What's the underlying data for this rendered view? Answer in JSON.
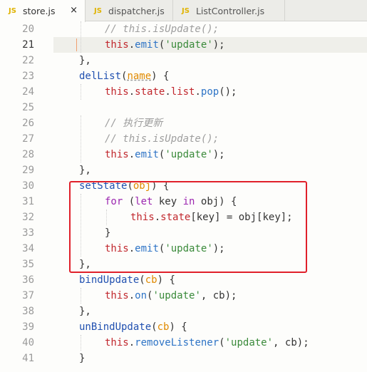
{
  "tabs": [
    {
      "icon": "JS",
      "label": "store.js",
      "close": "×",
      "active": true
    },
    {
      "icon": "JS",
      "label": "dispatcher.js",
      "active": false
    },
    {
      "icon": "JS",
      "label": "ListController.js",
      "active": false
    }
  ],
  "gutter": {
    "line_numbers": [
      "20",
      "21",
      "22",
      "23",
      "24",
      "25",
      "26",
      "27",
      "28",
      "29",
      "30",
      "31",
      "32",
      "33",
      "34",
      "35",
      "36",
      "37",
      "38",
      "39",
      "40",
      "41"
    ],
    "current_line": "21"
  },
  "code": {
    "l20": {
      "comment": "// this.isUpdate();"
    },
    "l21": {
      "this": "this",
      "dot": ".",
      "method": "emit",
      "open": "(",
      "str": "'update'",
      "close": ");"
    },
    "l22": {
      "text": "},"
    },
    "l23": {
      "name": "delList",
      "open": "(",
      "param": "name",
      "close": ") {"
    },
    "l24": {
      "this": "this",
      "dot1": ".",
      "state": "state",
      "dot2": ".",
      "list": "list",
      "dot3": ".",
      "method": "pop",
      "tail": "();"
    },
    "l26": {
      "comment": "// 执行更新"
    },
    "l27": {
      "comment": "// this.isUpdate();"
    },
    "l28": {
      "this": "this",
      "dot": ".",
      "method": "emit",
      "open": "(",
      "str": "'update'",
      "close": ");"
    },
    "l29": {
      "text": "},"
    },
    "l30": {
      "name": "setState",
      "open": "(",
      "param": "obj",
      "close": ") {"
    },
    "l31": {
      "kw_for": "for",
      "open": " (",
      "kw_let": "let",
      "mid": " key ",
      "kw_in": "in",
      "tail": " obj) {"
    },
    "l32": {
      "this": "this",
      "dot": ".",
      "state": "state",
      "tail": "[key] = obj[key];"
    },
    "l33": {
      "text": "}"
    },
    "l34": {
      "this": "this",
      "dot": ".",
      "method": "emit",
      "open": "(",
      "str": "'update'",
      "close": ");"
    },
    "l35": {
      "text": "},"
    },
    "l36": {
      "name": "bindUpdate",
      "open": "(",
      "param": "cb",
      "close": ") {"
    },
    "l37": {
      "this": "this",
      "dot": ".",
      "method": "on",
      "open": "(",
      "str": "'update'",
      "close": ", cb);"
    },
    "l38": {
      "text": "},"
    },
    "l39": {
      "name": "unBindUpdate",
      "open": "(",
      "param": "cb",
      "close": ") {"
    },
    "l40": {
      "this": "this",
      "dot": ".",
      "method": "removeListener",
      "open": "(",
      "str": "'update'",
      "close": ", cb);"
    },
    "l41": {
      "text": "}"
    }
  },
  "colors": {
    "keyword": "#9c27b0",
    "function": "#2e74c6",
    "string": "#3a8a3a",
    "this": "#c1272d",
    "param": "#e08a00",
    "comment": "#9e9e9e",
    "highlight_box": "#e0202a",
    "tab_icon": "#e0b300"
  }
}
